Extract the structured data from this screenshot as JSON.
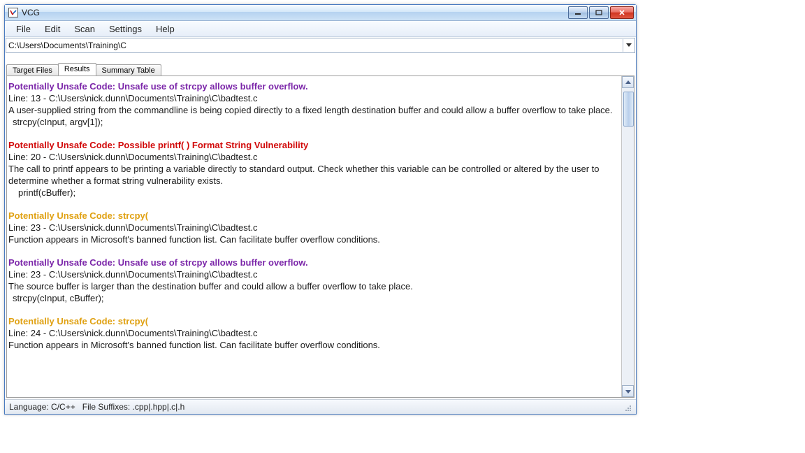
{
  "window": {
    "title": "VCG"
  },
  "menu": {
    "items": [
      "File",
      "Edit",
      "Scan",
      "Settings",
      "Help"
    ]
  },
  "path": {
    "value": "C:\\Users\\Documents\\Training\\C"
  },
  "tabs": {
    "items": [
      "Target Files",
      "Results",
      "Summary Table"
    ],
    "active_index": 1
  },
  "results": [
    {
      "title": "Potentially Unsafe Code: Unsafe use of strcpy allows buffer overflow.",
      "severity": "purple",
      "line_label": "Line: 13 - C:\\Users\\nick.dunn\\Documents\\Training\\C\\badtest.c",
      "description": "A user-supplied string from the commandline is being copied directly to a fixed length destination buffer and could allow a buffer overflow to take place.",
      "code": "strcpy(cInput, argv[1]);"
    },
    {
      "title": "Potentially Unsafe Code: Possible printf( ) Format String Vulnerability",
      "severity": "red",
      "line_label": "Line: 20 - C:\\Users\\nick.dunn\\Documents\\Training\\C\\badtest.c",
      "description": "The call to printf appears to be printing a variable directly to standard output. Check whether this variable can be controlled or altered by the user to determine whether a format string vulnerability exists.",
      "code": "printf(cBuffer);"
    },
    {
      "title": "Potentially Unsafe Code: strcpy(",
      "severity": "orange",
      "line_label": "Line: 23 - C:\\Users\\nick.dunn\\Documents\\Training\\C\\badtest.c",
      "description": "Function appears in Microsoft's banned function list. Can facilitate buffer overflow conditions.",
      "code": ""
    },
    {
      "title": "Potentially Unsafe Code: Unsafe use of strcpy allows buffer overflow.",
      "severity": "purple",
      "line_label": "Line: 23 - C:\\Users\\nick.dunn\\Documents\\Training\\C\\badtest.c",
      "description": "The source buffer is larger than the destination buffer and could allow a buffer overflow to take place.",
      "code": "strcpy(cInput, cBuffer);"
    },
    {
      "title": "Potentially Unsafe Code: strcpy(",
      "severity": "orange",
      "line_label": "Line: 24 - C:\\Users\\nick.dunn\\Documents\\Training\\C\\badtest.c",
      "description": "Function appears in Microsoft's banned function list. Can facilitate buffer overflow conditions.",
      "code": ""
    }
  ],
  "status": {
    "language_label": "Language: C/C++",
    "suffix_label": "File Suffixes: .cpp|.hpp|.c|.h"
  }
}
